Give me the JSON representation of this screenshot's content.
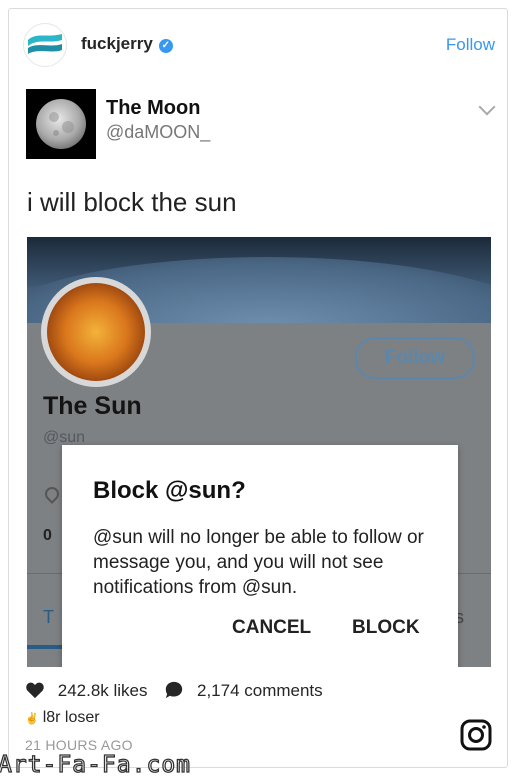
{
  "header": {
    "username": "fuckjerry",
    "verified_icon": "check-icon",
    "follow_label": "Follow"
  },
  "tweet": {
    "name": "The Moon",
    "handle": "@daMOON_",
    "text": "i will block the sun",
    "profile": {
      "follow_label": "Follow",
      "name": "The Sun",
      "handle": "@sun",
      "count": "0",
      "tab_left": "T",
      "tab_right": "s"
    },
    "dialog": {
      "title": "Block @sun?",
      "body": "@sun will no longer be able to follow or message you, and you will not see notifications from @sun.",
      "cancel_label": "CANCEL",
      "block_label": "BLOCK"
    }
  },
  "stats": {
    "likes": "242.8k likes",
    "comments": "2,174 comments"
  },
  "caption": "l8r loser",
  "timestamp": "21 HOURS AGO",
  "watermark": "Art-Fa-Fa.com",
  "colors": {
    "link_blue": "#3897f0",
    "twitter_blue": "#5b87ad"
  }
}
